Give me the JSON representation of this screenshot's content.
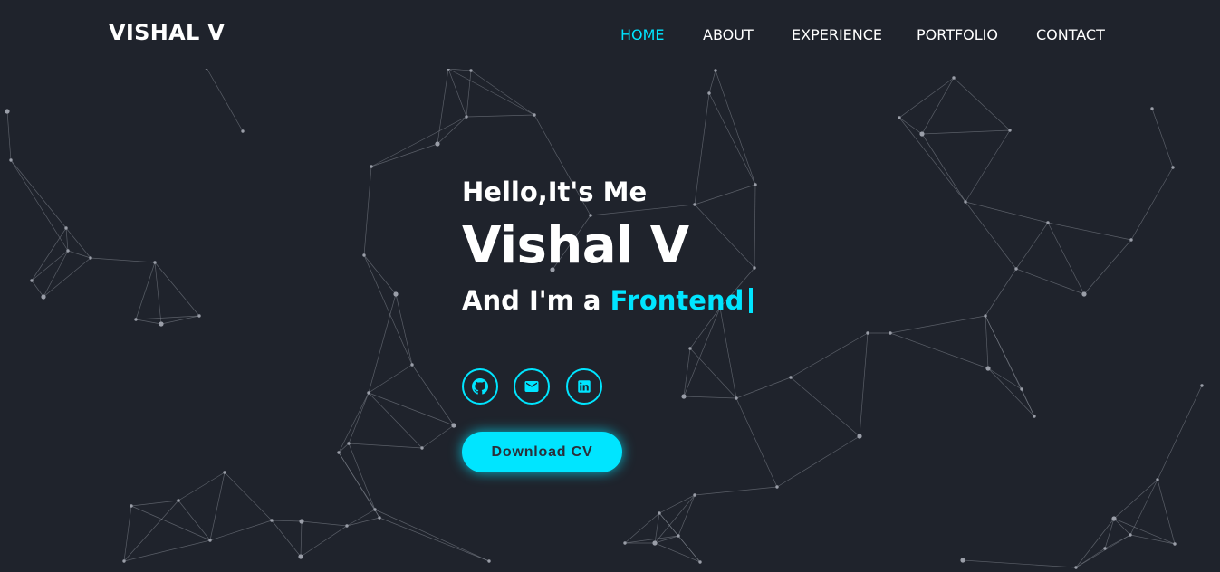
{
  "brand": {
    "name": "VISHAL V"
  },
  "nav": {
    "items": [
      {
        "label": "HOME",
        "active": true
      },
      {
        "label": "ABOUT",
        "active": false
      },
      {
        "label": "EXPERIENCE",
        "active": false
      },
      {
        "label": "PORTFOLIO",
        "active": false
      },
      {
        "label": "CONTACT",
        "active": false
      }
    ]
  },
  "hero": {
    "greeting": "Hello,It's Me",
    "name": "Vishal V",
    "role_prefix": "And I'm a",
    "role": "Frontend",
    "socials": [
      {
        "icon": "github-icon"
      },
      {
        "icon": "mail-icon"
      },
      {
        "icon": "linkedin-icon"
      }
    ],
    "download_label": "Download CV"
  },
  "colors": {
    "background": "#1f232c",
    "accent": "#00e5ff",
    "text": "#ffffff"
  }
}
